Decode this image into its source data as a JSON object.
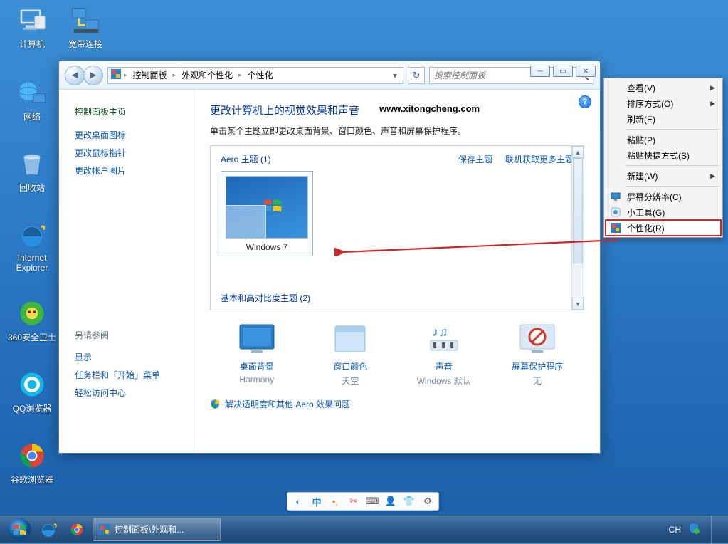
{
  "desktop_icons": [
    {
      "name": "computer",
      "label": "计算机"
    },
    {
      "name": "broadband",
      "label": "宽带连接"
    },
    {
      "name": "network",
      "label": "网络"
    },
    {
      "name": "recycle",
      "label": "回收站"
    },
    {
      "name": "ie",
      "label": "Internet Explorer"
    },
    {
      "name": "360",
      "label": "360安全卫士"
    },
    {
      "name": "qq",
      "label": "QQ浏览器"
    },
    {
      "name": "chrome",
      "label": "谷歌浏览器"
    }
  ],
  "window": {
    "breadcrumb": [
      "控制面板",
      "外观和个性化",
      "个性化"
    ],
    "search_placeholder": "搜索控制面板",
    "sidebar": {
      "home": "控制面板主页",
      "links": [
        "更改桌面图标",
        "更改鼠标指针",
        "更改帐户图片"
      ],
      "seealso_label": "另请参阅",
      "seealso": [
        "显示",
        "任务栏和「开始」菜单",
        "轻松访问中心"
      ]
    },
    "content": {
      "title": "更改计算机上的视觉效果和声音",
      "watermark": "www.xitongcheng.com",
      "subtitle": "单击某个主题立即更改桌面背景、窗口颜色、声音和屏幕保护程序。",
      "aero_label": "Aero 主题 (1)",
      "save_theme": "保存主题",
      "get_more": "联机获取更多主题",
      "theme_name": "Windows 7",
      "hc_label": "基本和高对比度主题 (2)",
      "bottom": [
        {
          "name": "desktop-bg",
          "title": "桌面背景",
          "value": "Harmony"
        },
        {
          "name": "window-color",
          "title": "窗口颜色",
          "value": "天空"
        },
        {
          "name": "sound",
          "title": "声音",
          "value": "Windows 默认"
        },
        {
          "name": "screensaver",
          "title": "屏幕保护程序",
          "value": "无"
        }
      ],
      "aero_troubleshoot": "解决透明度和其他 Aero 效果问题"
    }
  },
  "context_menu": [
    {
      "label": "查看(V)",
      "sub": true
    },
    {
      "label": "排序方式(O)",
      "sub": true
    },
    {
      "label": "刷新(E)"
    },
    {
      "sep": true
    },
    {
      "label": "粘贴(P)"
    },
    {
      "label": "粘贴快捷方式(S)"
    },
    {
      "sep": true
    },
    {
      "label": "新建(W)",
      "sub": true
    },
    {
      "sep": true
    },
    {
      "label": "屏幕分辨率(C)",
      "icon": "monitor"
    },
    {
      "label": "小工具(G)",
      "icon": "gadget"
    },
    {
      "label": "个性化(R)",
      "icon": "personalize",
      "highlighted": true
    }
  ],
  "taskbar": {
    "task_title": "控制面板\\外观和...",
    "lang": "CH"
  }
}
